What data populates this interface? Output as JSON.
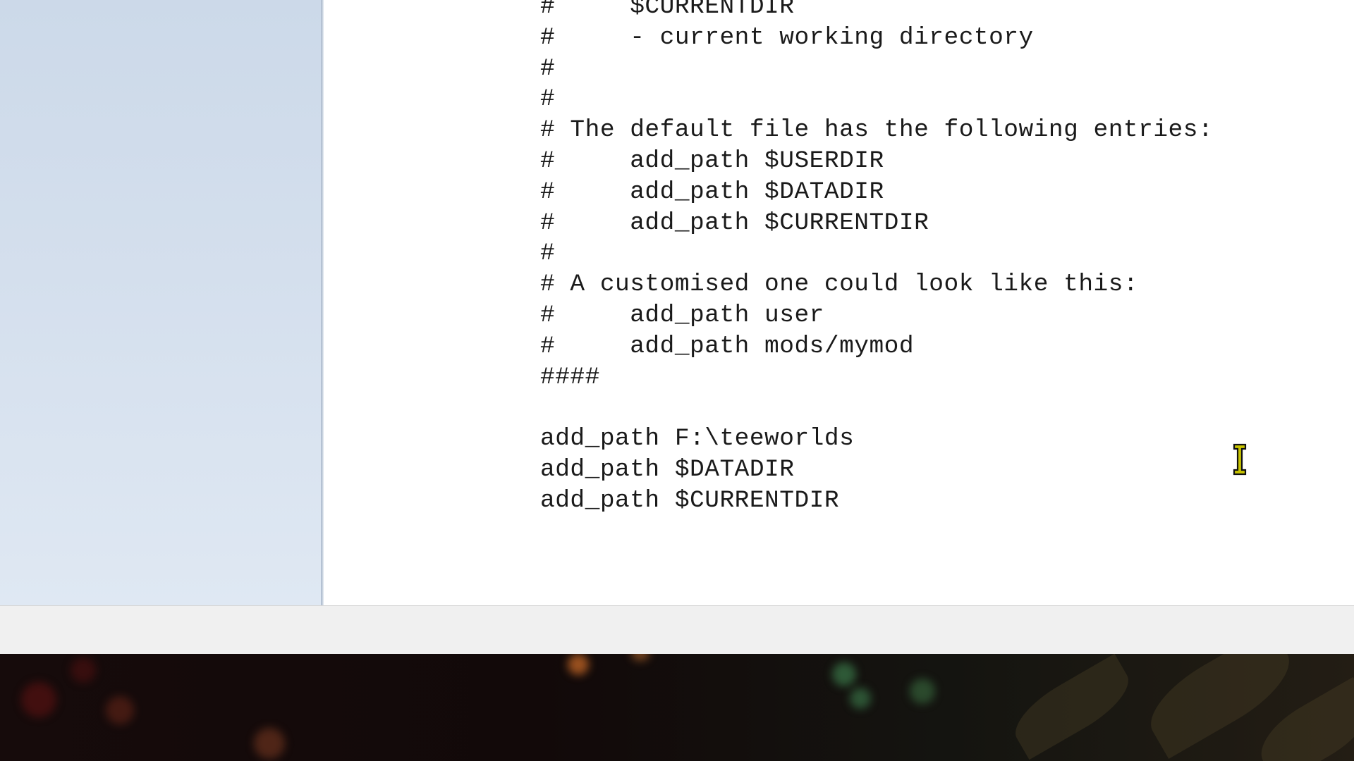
{
  "editor": {
    "lines": [
      "#     $CURRENTDIR",
      "#     - current working directory",
      "#",
      "#",
      "# The default file has the following entries:",
      "#     add_path $USERDIR",
      "#     add_path $DATADIR",
      "#     add_path $CURRENTDIR",
      "#",
      "# A customised one could look like this:",
      "#     add_path user",
      "#     add_path mods/mymod",
      "####",
      "",
      "add_path F:\\teeworlds",
      "add_path $DATADIR",
      "add_path $CURRENTDIR"
    ],
    "cursor_icon": "i-beam-text-cursor-icon"
  },
  "colors": {
    "editor_background": "#ffffff",
    "text": "#1a1a1a",
    "left_pane": "#d4dfed",
    "status_bar": "#f0f0f0",
    "cursor_fill": "#c8c400"
  }
}
